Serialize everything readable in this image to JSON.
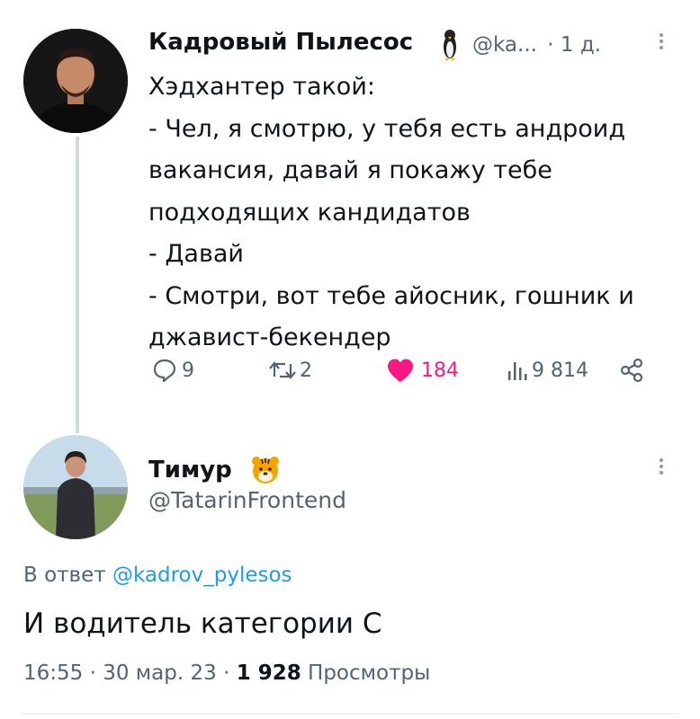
{
  "tweet": {
    "author_name": "Кадровый Пылесос",
    "author_badge": "penguin-emoji",
    "handle": "@ka...",
    "separator": "·",
    "time": "1 д.",
    "lines": [
      "Хэдхантер такой:",
      "- Чел, я смотрю, у тебя есть андроид",
      "вакансия, давай я покажу тебе",
      "подходящих кандидатов",
      "- Давай",
      "- Смотри, вот тебе айосник, гошник и",
      "джавист-бекендер"
    ],
    "stats": {
      "replies": "9",
      "retweets": "2",
      "likes": "184",
      "views": "9 814"
    }
  },
  "reply": {
    "author_name": "Тимур",
    "author_badge": "tiger-emoji",
    "handle": "@TatarinFrontend",
    "in_reply_prefix": "В ответ",
    "in_reply_handle": "@kadrov_pylesos",
    "text": "И водитель категории С",
    "time": "16:55",
    "separator": "·",
    "date": "30 мар. 23",
    "views_count": "1 928",
    "views_label": "Просмотры"
  },
  "colors": {
    "text": "#0f1419",
    "secondary": "#536471",
    "link": "#1d9bf0",
    "like": "#f91880",
    "thread_line": "#cfd9de"
  }
}
